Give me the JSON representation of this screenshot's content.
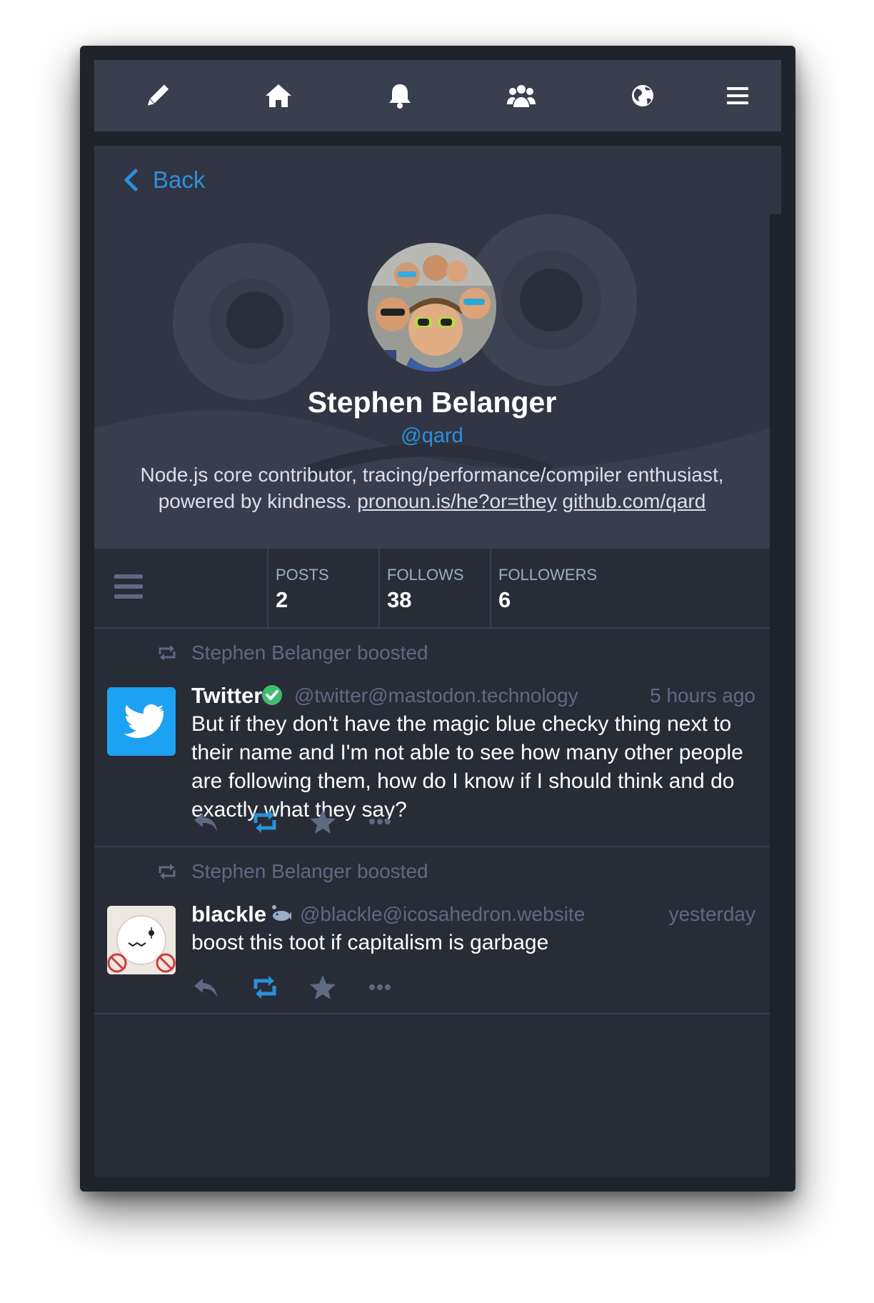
{
  "nav": {
    "icons": [
      "pencil-icon",
      "home-icon",
      "bell-icon",
      "users-icon",
      "globe-icon",
      "hamburger-menu-icon"
    ]
  },
  "back": {
    "label": "Back",
    "icon": "chevron-left-icon"
  },
  "profile": {
    "display_name": "Stephen Belanger",
    "acct": "@qard",
    "bio_text": "Node.js core contributor, tracing/performance/compiler enthusiast, powered by kindness.",
    "bio_links": [
      "pronoun.is/he?or=they",
      "github.com/qard"
    ]
  },
  "counters": {
    "posts_label": "POSTS",
    "posts_value": "2",
    "follows_label": "FOLLOWS",
    "follows_value": "38",
    "followers_label": "FOLLOWERS",
    "followers_value": "6"
  },
  "statuses": [
    {
      "boosted_by": "Stephen Belanger boosted",
      "name": "Twitter",
      "verified": true,
      "acct": "@twitter@mastodon.technology",
      "time": "5 hours ago",
      "content": "But if they don't have the magic blue checky thing next to their name and I'm not able to see how many other people are following them, how do I know if I should think and do exactly what they say?"
    },
    {
      "boosted_by": "Stephen Belanger boosted",
      "name": "blackle",
      "acct": "@blackle@icosahedron.website",
      "time": "yesterday",
      "content": "boost this toot if capitalism is garbage"
    }
  ],
  "colors": {
    "accent": "#2b90d9",
    "background": "#282c37",
    "nav": "#393f4f",
    "muted": "#606984",
    "verified": "#3dbc6d",
    "twitter_blue": "#1da1f2"
  }
}
